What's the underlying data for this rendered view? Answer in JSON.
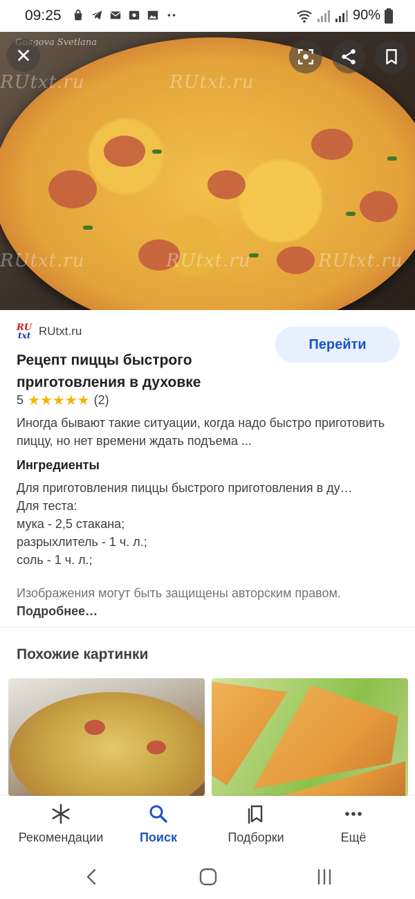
{
  "status_bar": {
    "time": "09:25",
    "battery": "90%",
    "icons_left": [
      "shopping-bag-icon",
      "telegram-icon",
      "mail-icon",
      "camera-icon",
      "gallery-icon",
      "more-dots-icon"
    ],
    "icons_right": [
      "wifi-icon",
      "signal-icon",
      "signal-icon",
      "battery-icon"
    ]
  },
  "hero": {
    "watermark": "RUtxt.ru",
    "signature": "Gusgova Svetlana",
    "buttons": [
      "close-icon",
      "lens-icon",
      "share-icon",
      "bookmark-icon"
    ]
  },
  "result": {
    "source_logo_top": "RU",
    "source_logo_bottom": "txt",
    "source_name": "RUtxt.ru",
    "go_label": "Перейти",
    "title": "Рецепт пиццы быстрого приготовления в духовке",
    "rating_value": "5",
    "rating_stars": "★★★★★",
    "rating_count": "(2)",
    "description": "Иногда бывают такие ситуации, когда надо быстро приготовить пиццу, но нет времени ждать подъема ...",
    "ingredients_title": "Ингредиенты",
    "ingredients": [
      "Для приготовления пиццы быстрого приготовления в ду…",
      "Для теста:",
      "мука - 2,5 стакана;",
      "разрыхлитель - 1 ч. л.;",
      "соль - 1 ч. л.;"
    ],
    "copyright_text": "Изображения могут быть защищены авторским правом.",
    "copyright_link": "Подробнее…"
  },
  "similar": {
    "title": "Похожие картинки"
  },
  "bottom_nav": {
    "items": [
      {
        "label": "Рекомендации",
        "icon": "asterisk-icon"
      },
      {
        "label": "Поиск",
        "icon": "search-icon"
      },
      {
        "label": "Подборки",
        "icon": "collections-icon"
      },
      {
        "label": "Ещё",
        "icon": "more-horizontal-icon"
      }
    ],
    "active": "Поиск"
  },
  "colors": {
    "accent": "#1a56c4",
    "go_button_bg": "#e8f0fe",
    "star": "#f5b301"
  }
}
